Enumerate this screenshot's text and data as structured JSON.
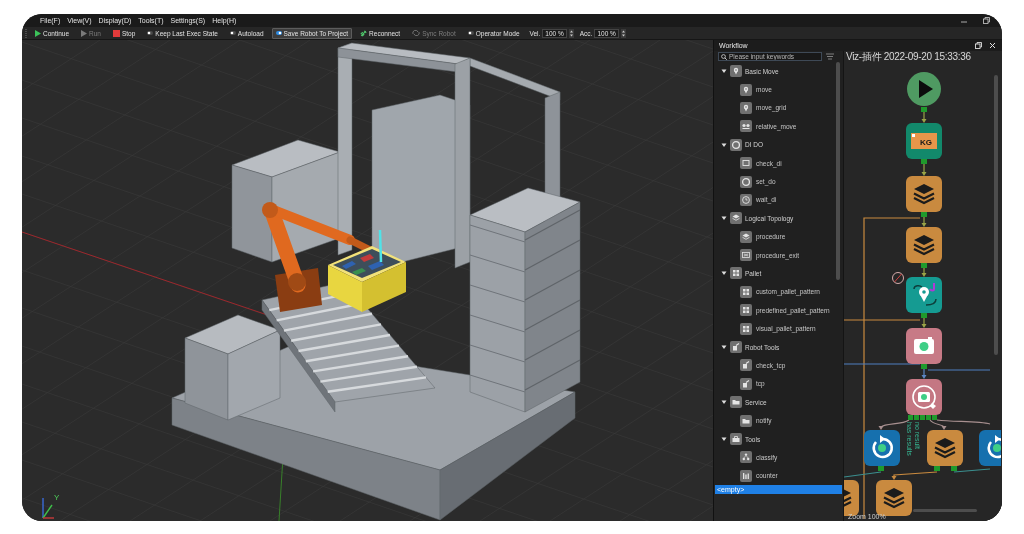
{
  "menu": [
    "File(F)",
    "View(V)",
    "Display(D)",
    "Tools(T)",
    "Settings(S)",
    "Help(H)"
  ],
  "toolbar": [
    {
      "kind": "button",
      "label": "Continue",
      "disabled": false
    },
    {
      "kind": "button",
      "label": "Run",
      "disabled": true
    },
    {
      "kind": "button",
      "label": "Stop",
      "disabled": false
    },
    {
      "kind": "toggle",
      "label": "Keep Last Exec State",
      "on": false
    },
    {
      "kind": "toggle",
      "label": "Autoload",
      "on": false
    },
    {
      "kind": "toggle",
      "label": "Save Robot To Project",
      "on": true
    },
    {
      "kind": "button",
      "label": "Reconnect",
      "disabled": false
    },
    {
      "kind": "button",
      "label": "Sync Robot",
      "disabled": true
    },
    {
      "kind": "toggle",
      "label": "Operator Mode",
      "on": false
    },
    {
      "kind": "spinner",
      "label": "Vel.",
      "value": "100 %"
    },
    {
      "kind": "spinner",
      "label": "Acc.",
      "value": "100 %"
    }
  ],
  "viewport": {
    "axis_label": "Y"
  },
  "workflow": {
    "title": "Workflow",
    "search": {
      "placeholder": "Please input keywords"
    },
    "tree": [
      {
        "label": "Basic Move",
        "expanded": true,
        "children": [
          {
            "label": "move"
          },
          {
            "label": "move_grid"
          },
          {
            "label": "relative_move"
          }
        ]
      },
      {
        "label": "DI DO",
        "expanded": true,
        "children": [
          {
            "label": "check_di"
          },
          {
            "label": "set_do"
          },
          {
            "label": "wait_di"
          }
        ]
      },
      {
        "label": "Logical Topology",
        "expanded": true,
        "children": [
          {
            "label": "procedure"
          },
          {
            "label": "procedure_exit"
          }
        ]
      },
      {
        "label": "Pallet",
        "expanded": true,
        "children": [
          {
            "label": "custom_pallet_pattern"
          },
          {
            "label": "predefined_pallet_pattern"
          },
          {
            "label": "visual_pallet_pattern"
          }
        ]
      },
      {
        "label": "Robot Tools",
        "expanded": true,
        "children": [
          {
            "label": "check_tcp"
          },
          {
            "label": "tcp"
          }
        ]
      },
      {
        "label": "Service",
        "expanded": true,
        "children": [
          {
            "label": "notify"
          }
        ]
      },
      {
        "label": "Tools",
        "expanded": true,
        "children": [
          {
            "label": "classify"
          },
          {
            "label": "counter"
          }
        ]
      }
    ],
    "list": [
      {
        "label": "<empty>",
        "selected": true
      }
    ]
  },
  "flow": {
    "title": "Viz-插件 2022-09-20 15:33:36",
    "nodes": [
      {
        "kind": "start"
      },
      {
        "kind": "kg",
        "label": "KG"
      },
      {
        "kind": "layers"
      },
      {
        "kind": "layers"
      },
      {
        "kind": "path"
      },
      {
        "kind": "camera"
      },
      {
        "kind": "camera_detect"
      },
      {
        "kind": "rotate"
      },
      {
        "kind": "layers"
      },
      {
        "kind": "rotate"
      },
      {
        "kind": "layers"
      },
      {
        "kind": "layers"
      }
    ],
    "port_labels": [
      "has results",
      "no result"
    ],
    "zoom": "Zoom 100%"
  }
}
